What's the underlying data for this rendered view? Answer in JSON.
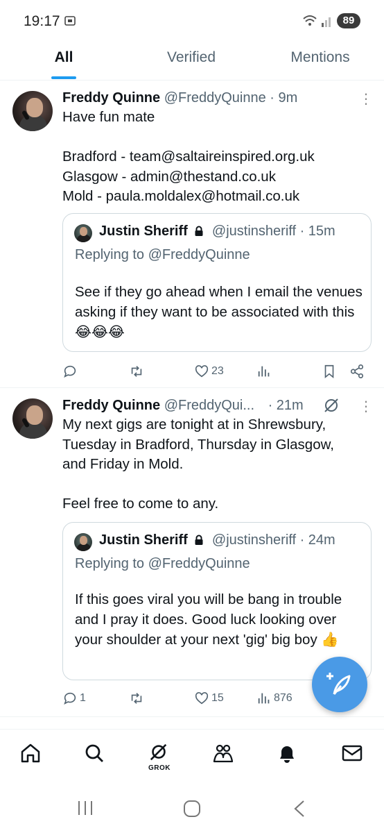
{
  "status_bar": {
    "time": "19:17",
    "battery": "89"
  },
  "tabs": [
    "All",
    "Verified",
    "Mentions"
  ],
  "posts": [
    {
      "author_name": "Freddy Quinne",
      "author_handle": "@FreddyQuinne",
      "time": "· 9m",
      "text": "Have fun mate\n\nBradford - team@saltaireinspired.org.uk\nGlasgow - admin@thestand.co.uk\nMold - paula.moldalex@hotmail.co.uk",
      "quote": {
        "author_name": "Justin Sheriff",
        "author_handle": "@justinsheriff",
        "time": "· 15m",
        "replying_to": "Replying to @FreddyQuinne",
        "text": "See if they go ahead when I email the venues asking if they want to be associated with this 😂😂😂"
      },
      "stats": {
        "replies": "",
        "reposts": "",
        "likes": "23",
        "views": ""
      }
    },
    {
      "author_name": "Freddy Quinne",
      "author_handle": "@FreddyQui...",
      "time": "· 21m",
      "text": "My next gigs are tonight at in Shrewsbury,\nTuesday in Bradford, Thursday in Glasgow,\nand Friday in Mold.\n\nFeel free to come to any.",
      "quote": {
        "author_name": "Justin Sheriff",
        "author_handle": "@justinsheriff",
        "time": "· 24m",
        "replying_to": "Replying to @FreddyQuinne",
        "text": "If this goes viral you will be bang in trouble and I pray it does. Good luck looking over your shoulder at your next 'gig' big boy 👍"
      },
      "stats": {
        "replies": "1",
        "reposts": "",
        "likes": "15",
        "views": "876"
      }
    }
  ],
  "bottom_nav": {
    "items": [
      "home-icon",
      "search-icon",
      "grok-icon",
      "communities-icon",
      "notifications-icon",
      "messages-icon"
    ],
    "grok_label": "GROK"
  },
  "colors": {
    "accent": "#1d9bf0",
    "fab": "#4a9ae6",
    "secondary_text": "#536471"
  }
}
